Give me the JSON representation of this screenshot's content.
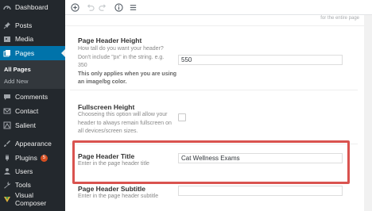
{
  "sidebar": {
    "items": [
      {
        "label": "Dashboard",
        "icon": "dashboard-icon"
      },
      {
        "label": "Posts",
        "icon": "pin-icon"
      },
      {
        "label": "Media",
        "icon": "media-icon"
      },
      {
        "label": "Pages",
        "icon": "pages-icon"
      },
      {
        "label": "Comments",
        "icon": "comments-icon"
      },
      {
        "label": "Contact",
        "icon": "mail-icon"
      },
      {
        "label": "Salient",
        "icon": "salient-icon"
      },
      {
        "label": "Appearance",
        "icon": "brush-icon"
      },
      {
        "label": "Plugins",
        "icon": "plugin-icon",
        "badge": "5"
      },
      {
        "label": "Users",
        "icon": "users-icon"
      },
      {
        "label": "Tools",
        "icon": "wrench-icon"
      },
      {
        "label": "Visual Composer",
        "icon": "vc-icon"
      }
    ],
    "submenu": [
      "All Pages",
      "Add New"
    ]
  },
  "colors": {
    "sidebar": "#23282d",
    "active": "#0073aa",
    "highlight": "#d9534f"
  },
  "toolbar": {
    "buttons": [
      "add-icon",
      "undo-icon",
      "redo-icon",
      "info-icon",
      "list-icon"
    ]
  },
  "panel": {
    "faded_text": "for the entire page",
    "header_height": {
      "label": "Page Header Height",
      "desc": [
        "How tall do you want your header?",
        "Don't include \"px\" in the string. e.g.",
        "350"
      ],
      "note": [
        "This only applies when you are using",
        "an image/bg color."
      ],
      "value": "550"
    },
    "fullscreen": {
      "label": "Fullscreen Height",
      "desc": [
        "Chooseing this option will allow your",
        "header to always remain fullscreen on",
        "all devices/screen sizes."
      ]
    },
    "header_title": {
      "label": "Page Header Title",
      "desc": "Enter in the page header title",
      "value": "Cat Wellness Exams"
    },
    "header_subtitle": {
      "label": "Page Header Subtitle",
      "desc": "Enter in the page header subtitle",
      "value": ""
    }
  }
}
